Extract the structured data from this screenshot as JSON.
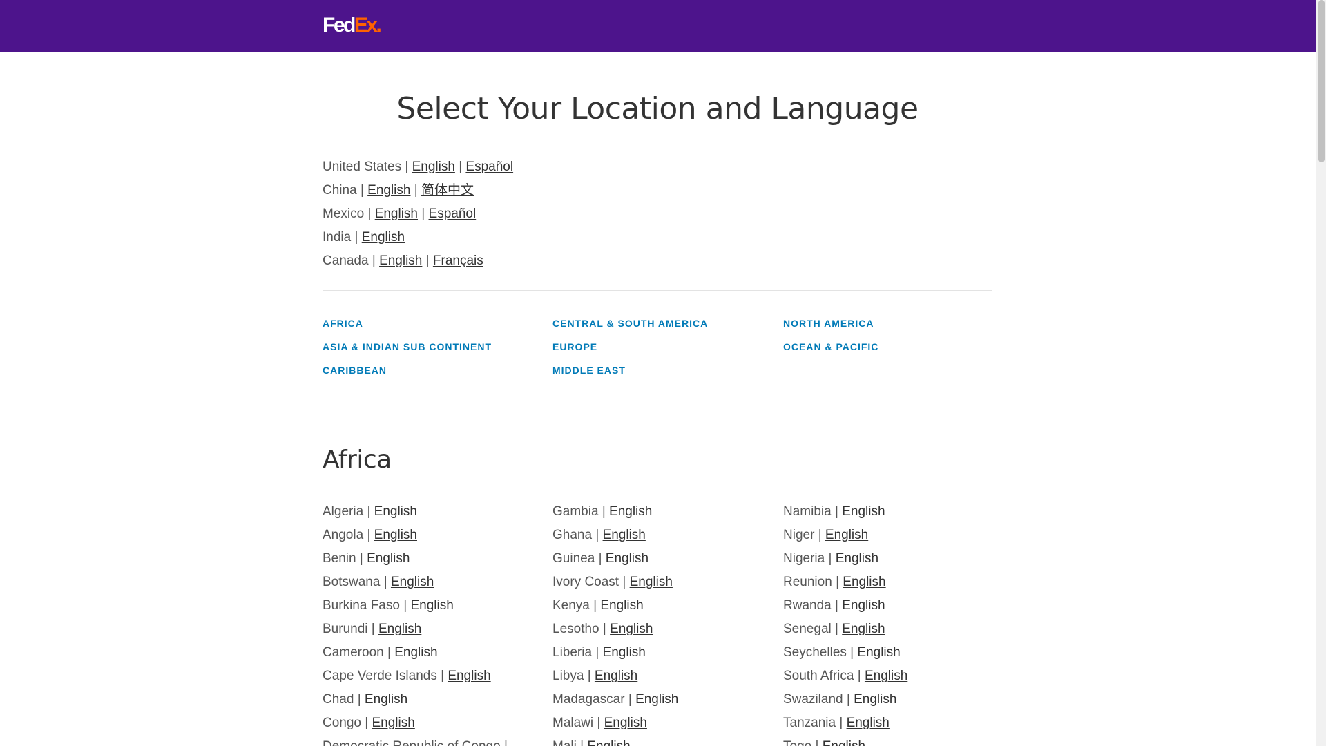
{
  "header": {
    "logo_fed": "Fed",
    "logo_ex": "Ex",
    "logo_dot": "."
  },
  "page_title": "Select Your Location and Language",
  "separator": "|",
  "featured": [
    {
      "country": "United States",
      "languages": [
        "English",
        "Español"
      ]
    },
    {
      "country": "China",
      "languages": [
        "English",
        "简体中文"
      ]
    },
    {
      "country": "Mexico",
      "languages": [
        "English",
        "Español"
      ]
    },
    {
      "country": "India",
      "languages": [
        "English"
      ]
    },
    {
      "country": "Canada",
      "languages": [
        "English",
        "Français"
      ]
    }
  ],
  "regions": [
    "AFRICA",
    "ASIA & INDIAN SUB CONTINENT",
    "CARIBBEAN",
    "CENTRAL & SOUTH AMERICA",
    "EUROPE",
    "MIDDLE EAST",
    "NORTH AMERICA",
    "OCEAN & PACIFIC"
  ],
  "africa": {
    "title": "Africa",
    "columns": [
      [
        {
          "country": "Algeria",
          "language": "English"
        },
        {
          "country": "Angola",
          "language": "English"
        },
        {
          "country": "Benin",
          "language": "English"
        },
        {
          "country": "Botswana",
          "language": "English"
        },
        {
          "country": "Burkina Faso",
          "language": "English"
        },
        {
          "country": "Burundi",
          "language": "English"
        },
        {
          "country": "Cameroon",
          "language": "English"
        },
        {
          "country": "Cape Verde Islands",
          "language": "English"
        },
        {
          "country": "Chad",
          "language": "English"
        },
        {
          "country": "Congo",
          "language": "English"
        },
        {
          "country": "Democratic Republic of Congo",
          "language": ""
        }
      ],
      [
        {
          "country": "Gambia",
          "language": "English"
        },
        {
          "country": "Ghana",
          "language": "English"
        },
        {
          "country": "Guinea",
          "language": "English"
        },
        {
          "country": "Ivory Coast",
          "language": "English"
        },
        {
          "country": "Kenya",
          "language": "English"
        },
        {
          "country": "Lesotho",
          "language": "English"
        },
        {
          "country": "Liberia",
          "language": "English"
        },
        {
          "country": "Libya",
          "language": "English"
        },
        {
          "country": "Madagascar",
          "language": "English"
        },
        {
          "country": "Malawi",
          "language": "English"
        },
        {
          "country": "Mali",
          "language": "English"
        }
      ],
      [
        {
          "country": "Namibia",
          "language": "English"
        },
        {
          "country": "Niger",
          "language": "English"
        },
        {
          "country": "Nigeria",
          "language": "English"
        },
        {
          "country": "Reunion",
          "language": "English"
        },
        {
          "country": "Rwanda",
          "language": "English"
        },
        {
          "country": "Senegal",
          "language": "English"
        },
        {
          "country": "Seychelles",
          "language": "English"
        },
        {
          "country": "South Africa",
          "language": "English"
        },
        {
          "country": "Swaziland",
          "language": "English"
        },
        {
          "country": "Tanzania",
          "language": "English"
        },
        {
          "country": "Togo",
          "language": "English"
        }
      ]
    ]
  },
  "colors": {
    "header_purple": "#4d148c",
    "brand_orange": "#ff6200",
    "region_link_blue": "#007ab7",
    "text_gray": "#555555"
  }
}
